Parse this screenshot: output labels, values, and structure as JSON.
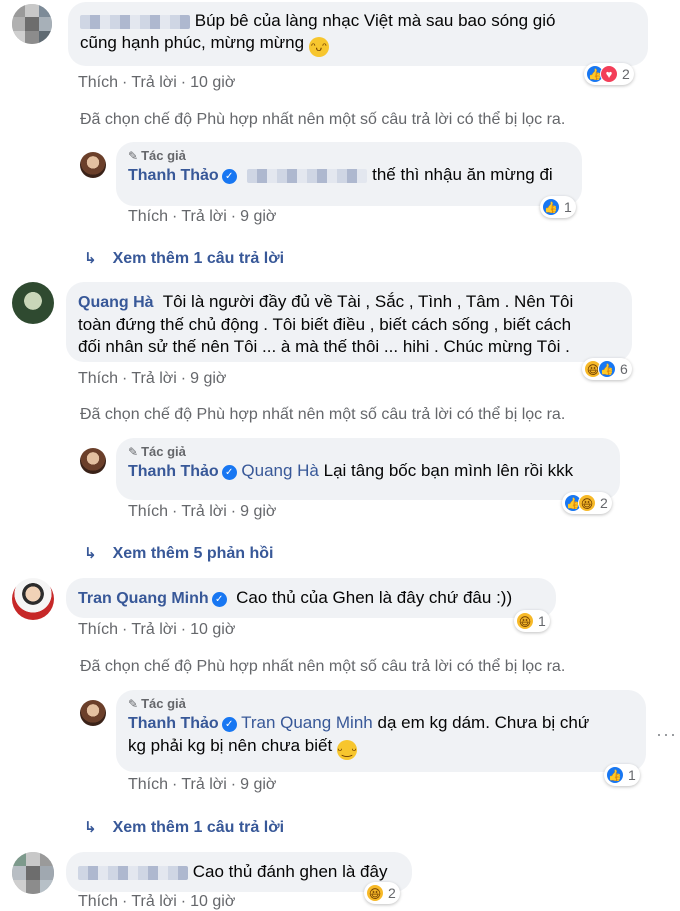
{
  "labels": {
    "like": "Thích",
    "reply": "Trả lời",
    "author": "Tác giả",
    "filter_notice": "Đã chọn chế độ Phù hợp nhất nên một số câu trả lời có thể bị lọc ra."
  },
  "comments": [
    {
      "text_line1": "Búp bê của làng nhạc Việt mà sau bao sóng gió",
      "text_line2": "cũng hạnh phúc, mừng mừng",
      "time": "10 giờ",
      "reaction_count": "2",
      "reply": {
        "author": "Thanh Thảo",
        "text": "thế thì nhậu ăn mừng đi",
        "time": "9 giờ",
        "reaction_count": "1"
      },
      "more": "Xem thêm 1 câu trả lời"
    },
    {
      "author": "Quang Hà",
      "text_line1": "Tôi là người đầy đủ về Tài , Sắc , Tình , Tâm . Nên Tôi",
      "text_line2": "toàn đứng thế chủ động . Tôi biết điều , biết cách sống , biết cách",
      "text_line3": "đối nhân sử thế nên Tôi ... à mà thế thôi ... hihi . Chúc mừng Tôi .",
      "time": "9 giờ",
      "reaction_count": "6",
      "reply": {
        "author": "Thanh Thảo",
        "mention": "Quang Hà",
        "text": "Lại tâng bốc bạn mình lên rồi kkk",
        "time": "9 giờ",
        "reaction_count": "2"
      },
      "more": "Xem thêm 5 phản hồi"
    },
    {
      "author": "Tran Quang Minh",
      "text": "Cao thủ của Ghen là đây chứ đâu :))",
      "time": "10 giờ",
      "reaction_count": "1",
      "reply": {
        "author": "Thanh Thảo",
        "mention": "Tran Quang Minh",
        "text_line1": "dạ em kg dám. Chưa bị chứ",
        "text_line2": "kg phải kg bị nên chưa biết",
        "time": "9 giờ",
        "reaction_count": "1"
      },
      "more": "Xem thêm 1 câu trả lời"
    },
    {
      "text": "Cao thủ đánh ghen là đây",
      "time": "10 giờ",
      "reaction_count": "2"
    }
  ]
}
